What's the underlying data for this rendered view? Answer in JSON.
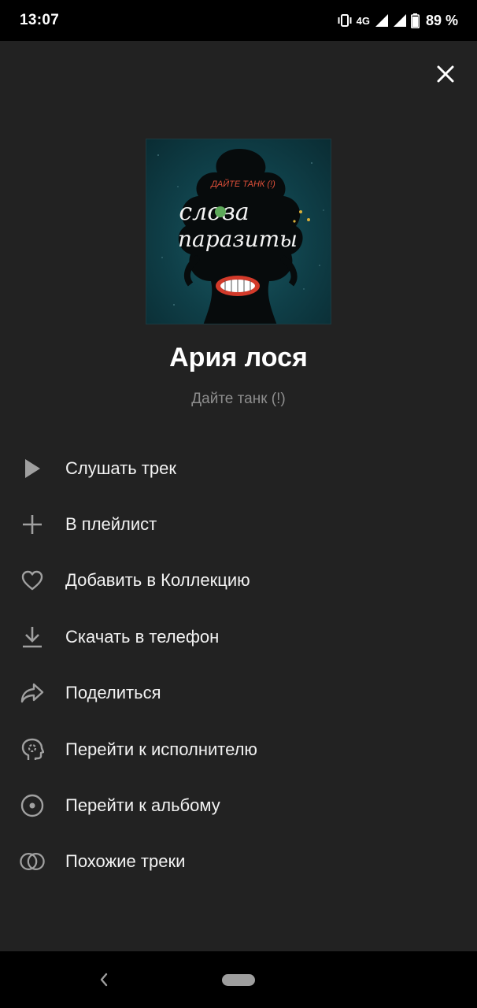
{
  "status_bar": {
    "time": "13:07",
    "network": "4G",
    "battery": "89 %",
    "icons": [
      "vibrate-icon",
      "signal-icon",
      "signal-icon",
      "battery-icon"
    ]
  },
  "sheet": {
    "close_icon": "close-icon"
  },
  "track": {
    "title": "Ария лося",
    "artist": "Дайте танк (!)",
    "cover": {
      "band_text": "ДАЙТЕ ТАНК (!)",
      "album_line1": "слова",
      "album_line2": "паразиты"
    }
  },
  "menu": {
    "items": [
      {
        "label": "Слушать трек",
        "icon": "play-icon"
      },
      {
        "label": "В плейлист",
        "icon": "plus-icon"
      },
      {
        "label": "Добавить в Коллекцию",
        "icon": "heart-icon"
      },
      {
        "label": "Скачать в телефон",
        "icon": "download-icon"
      },
      {
        "label": "Поделиться",
        "icon": "share-icon"
      },
      {
        "label": "Перейти к исполнителю",
        "icon": "artist-icon"
      },
      {
        "label": "Перейти к альбому",
        "icon": "album-icon"
      },
      {
        "label": "Похожие треки",
        "icon": "similar-icon"
      }
    ]
  },
  "colors": {
    "sheet_background": "#222222",
    "primary_text": "#f2f2f2",
    "secondary_text": "#8e8e8e",
    "icon_color": "#a0a0a0"
  }
}
